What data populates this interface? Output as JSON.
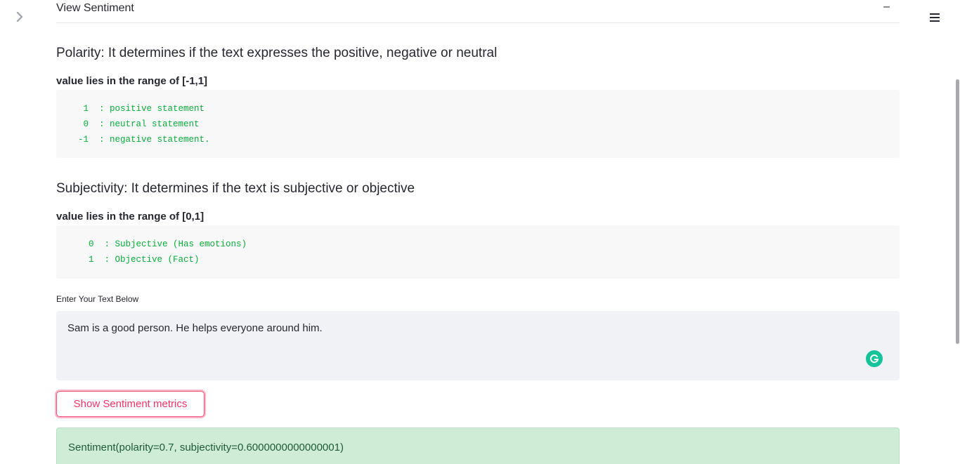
{
  "expander": {
    "title": "View Sentiment",
    "collapse_glyph": "–"
  },
  "polarity": {
    "heading": "Polarity: It determines if the text expresses the positive, negative or neutral",
    "subheading": "value lies in the range of [-1,1]",
    "lines": [
      "   1  : positive statement",
      "   0  : neutral statement",
      "  -1  : negative statement."
    ]
  },
  "subjectivity": {
    "heading": "Subjectivity: It determines if the text is subjective or objective",
    "subheading": "value lies in the range of [0,1]",
    "lines": [
      "    0  : Subjective (Has emotions)",
      "    1  : Objective (Fact)"
    ]
  },
  "input": {
    "label": "Enter Your Text Below",
    "value": "Sam is a good person. He helps everyone around him."
  },
  "button": {
    "label": "Show Sentiment metrics"
  },
  "result": {
    "text": "Sentiment(polarity=0.7, subjectivity=0.6000000000000001)"
  },
  "icons": {
    "sidebar_toggle": "chevron-right-icon",
    "menu": "hamburger-menu-icon",
    "grammarly": "grammarly-icon"
  },
  "colors": {
    "accent": "#f63366",
    "code_text": "#09ab3b",
    "success_bg": "#cfecd7",
    "input_bg": "#f0f2f6"
  }
}
